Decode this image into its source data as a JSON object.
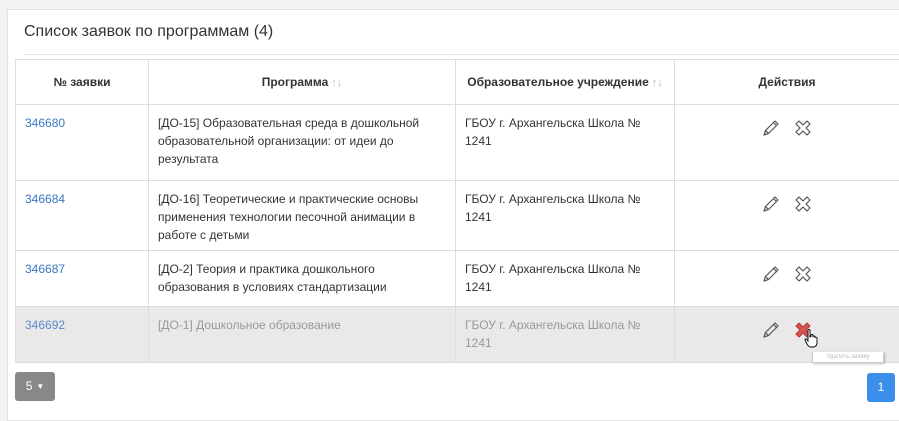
{
  "panel": {
    "title": "Список заявок по программам (4)"
  },
  "table": {
    "headers": {
      "num": "№ заявки",
      "program": "Программа",
      "org": "Образовательное учреждение",
      "actions": "Действия"
    },
    "sort_icon": "↑↓",
    "rows": [
      {
        "num": "346680",
        "program": "[ДО-15] Образовательная среда в дошкольной образовательной организации: от идеи до результата",
        "org": "ГБОУ г. Архангельска Школа № 1241"
      },
      {
        "num": "346684",
        "program": "[ДО-16] Теоретические и практические основы применения технологии песочной анимации в работе с детьми",
        "org": "ГБОУ г. Архангельска Школа № 1241"
      },
      {
        "num": "346687",
        "program": "[ДО-2] Теория и практика дошкольного образования в условиях стандартизации",
        "org": "ГБОУ г. Архангельска Школа № 1241"
      },
      {
        "num": "346692",
        "program": "[ДО-1] Дошкольное образование",
        "org": "ГБОУ г. Архангельска Школа № 1241"
      }
    ],
    "icons": {
      "edit": "pencil-icon",
      "delete": "cross-icon"
    }
  },
  "pagination": {
    "page_size": "5",
    "current_page": "1"
  },
  "tooltip": {
    "text": "Удалить заявку"
  },
  "colors": {
    "link": "#3a78c4",
    "page_button": "#3b8eea",
    "delete_hover": "#d9534f",
    "row_hover": "#e9e9e9"
  }
}
